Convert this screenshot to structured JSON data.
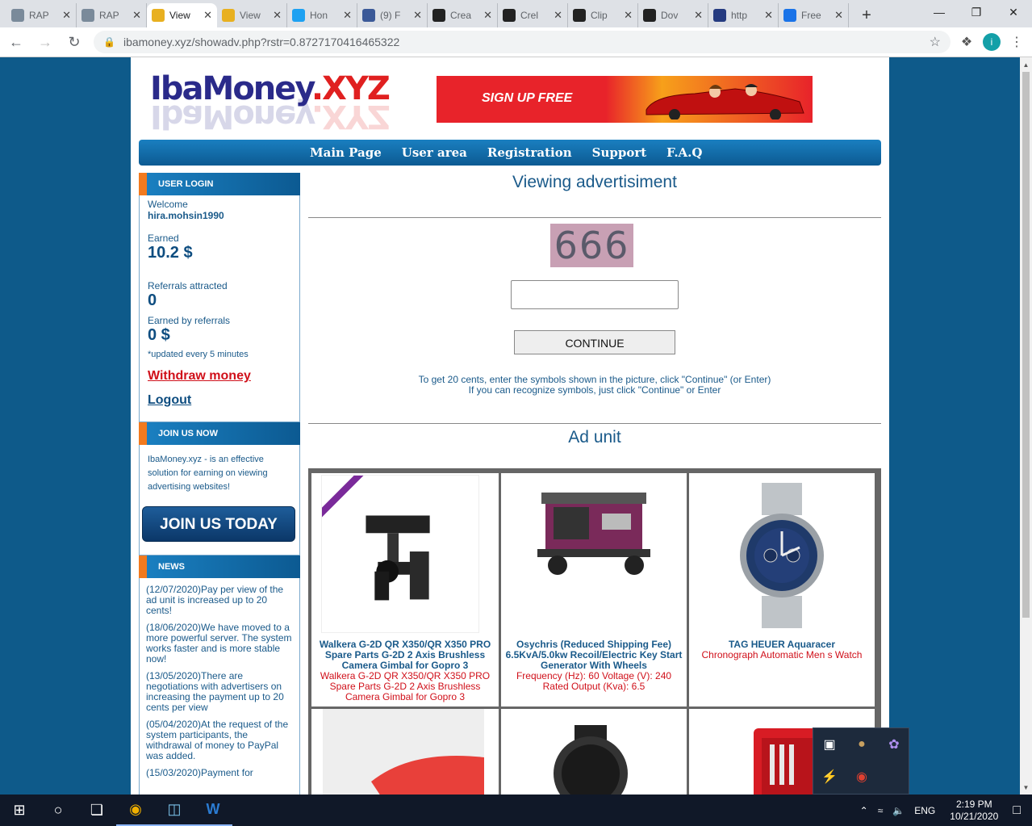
{
  "browser": {
    "tabs": [
      {
        "label": "RAP",
        "color": "#7a8a9a"
      },
      {
        "label": "RAP",
        "color": "#7a8a9a"
      },
      {
        "label": "View",
        "color": "#e8b020",
        "active": true
      },
      {
        "label": "View",
        "color": "#e8b020"
      },
      {
        "label": "Hon",
        "color": "#1da1f2"
      },
      {
        "label": "(9) F",
        "color": "#3b5998"
      },
      {
        "label": "Crea",
        "color": "#222222"
      },
      {
        "label": "Crel",
        "color": "#222222"
      },
      {
        "label": "Clip",
        "color": "#222222"
      },
      {
        "label": "Dov",
        "color": "#222222"
      },
      {
        "label": "http",
        "color": "#253b80"
      },
      {
        "label": "Free",
        "color": "#1a73e8"
      }
    ],
    "url": "ibamoney.xyz/showadv.php?rstr=0.8727170416465322",
    "profile_initial": "i"
  },
  "site": {
    "logo_text": "IbaMoney",
    "logo_tld": ".XYZ",
    "banner_text": "SIGN UP FREE",
    "menu": [
      "Main Page",
      "User area",
      "Registration",
      "Support",
      "F.A.Q"
    ]
  },
  "sidebar": {
    "login_header": "USER LOGIN",
    "welcome_label": "Welcome",
    "username": "hira.mohsin1990",
    "earned_label": "Earned",
    "earned_value": "10.2 $",
    "referrals_label": "Referrals attracted",
    "referrals_value": "0",
    "ref_earned_label": "Earned by referrals",
    "ref_earned_value": "0 $",
    "update_note": "*updated every 5 minutes",
    "withdraw_link": "Withdraw money",
    "logout_link": "Logout",
    "join_header": "JOIN US NOW",
    "join_text": "IbaMoney.xyz - is an effective solution for earning on viewing advertising websites!",
    "join_button": "JOIN US TODAY",
    "news_header": "NEWS",
    "news": [
      "(12/07/2020)Pay per view of the ad unit is increased up to 20 cents!",
      "(18/06/2020)We have moved to a more powerful server. The system works faster and is more stable now!",
      "(13/05/2020)There are negotiations with advertisers on increasing the payment up to 20 cents per view",
      "(05/04/2020)At the request of the system participants, the withdrawal of money to PayPal was added.",
      "(15/03/2020)Payment for"
    ]
  },
  "main": {
    "title": "Viewing advertisiment",
    "captcha": "666",
    "continue_button": "CONTINUE",
    "hint_line1": "To get 20 cents, enter the symbols shown in the picture, click \"Continue\" (or Enter)",
    "hint_line2": "If you can recognize symbols, just click \"Continue\" or Enter",
    "ad_unit_title": "Ad unit",
    "ads": [
      {
        "title": "Walkera G-2D QR X350/QR X350 PRO Spare Parts G-2D 2 Axis Brushless Camera Gimbal for Gopro 3",
        "desc": "Walkera G-2D QR X350/QR X350 PRO Spare Parts G-2D 2 Axis Brushless Camera Gimbal for Gopro 3"
      },
      {
        "title": "Osychris (Reduced Shipping Fee) 6.5KvA/5.0kw Recoil/Electric Key Start Generator With Wheels",
        "desc": "Frequency (Hz): 60 Voltage (V): 240 Rated Output (Kva): 6.5"
      },
      {
        "title": "TAG HEUER Aquaracer",
        "desc": "Chronograph Automatic Men s Watch"
      }
    ]
  },
  "taskbar": {
    "lang": "ENG",
    "time": "2:19 PM",
    "date": "10/21/2020"
  }
}
